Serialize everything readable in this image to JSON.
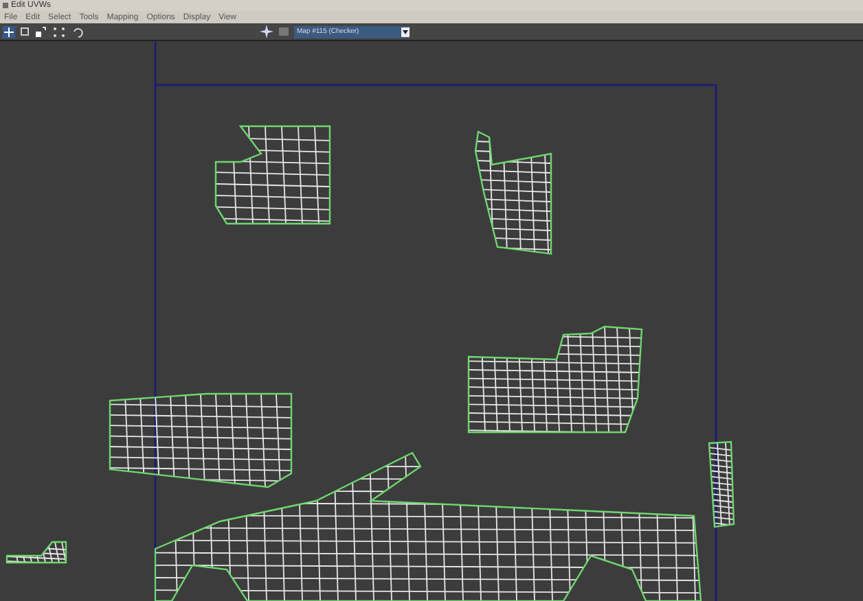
{
  "window": {
    "title": "Edit UVWs"
  },
  "menu": [
    "File",
    "Edit",
    "Select",
    "Tools",
    "Mapping",
    "Options",
    "Display",
    "View"
  ],
  "toolbar": {
    "map_dropdown": {
      "value": "Map #115  (Checker)"
    }
  }
}
